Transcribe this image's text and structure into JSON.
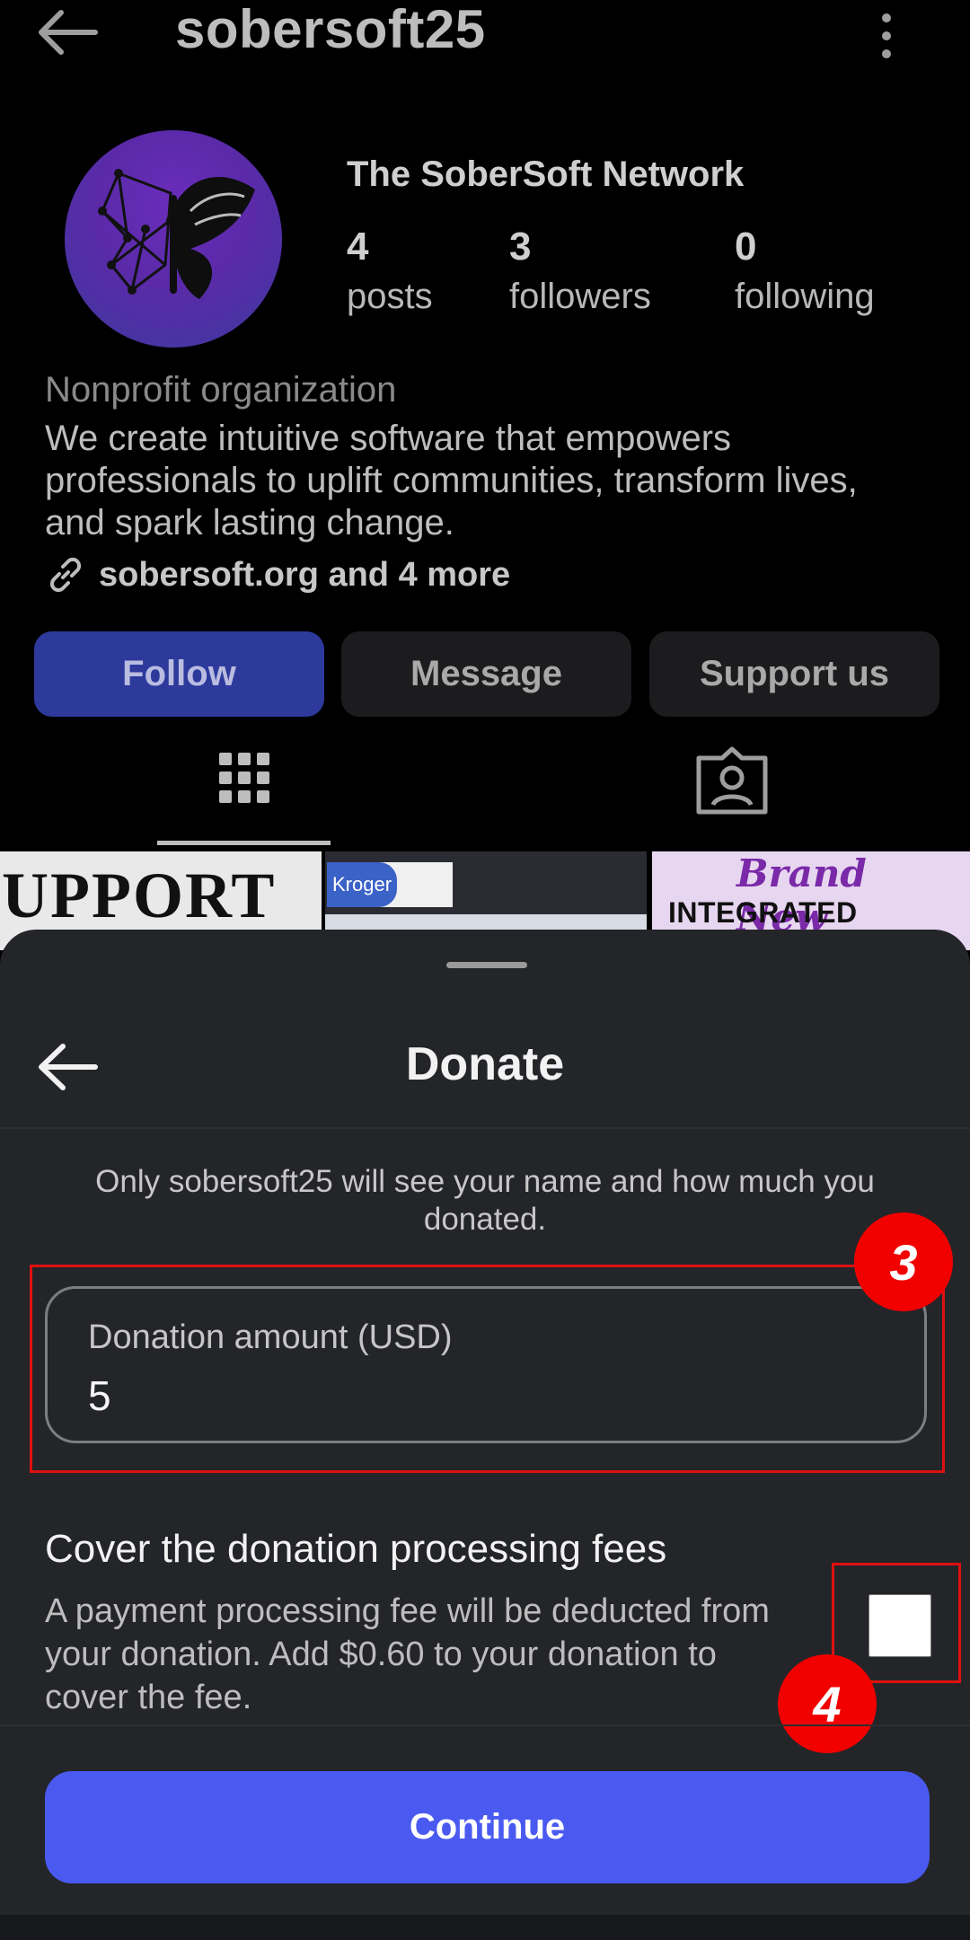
{
  "header": {
    "username": "sobersoft25",
    "back_icon": "arrow-left-icon",
    "menu_icon": "more-vertical-icon"
  },
  "profile": {
    "display_name": "The SoberSoft Network",
    "stats": [
      {
        "value": "4",
        "label": "posts"
      },
      {
        "value": "3",
        "label": "followers"
      },
      {
        "value": "0",
        "label": "following"
      }
    ],
    "category": "Nonprofit organization",
    "bio": "We create intuitive software that empowers professionals to uplift communities, transform lives, and spark lasting change.",
    "link": "sobersoft.org and 4 more",
    "avatar_colors": [
      "#6a2dbb",
      "#3c3a9e"
    ]
  },
  "actions": {
    "follow": "Follow",
    "message": "Message",
    "support": "Support us"
  },
  "tabs": {
    "grid_icon": "grid-icon",
    "tagged_icon": "tagged-person-icon"
  },
  "thumbnails": [
    {
      "text": "UPPORT U"
    },
    {
      "text": "Kroger"
    },
    {
      "script_text": "Brand New",
      "text": "INTEGRATED RECOVERY"
    }
  ],
  "sheet": {
    "title": "Donate",
    "privacy_note": "Only sobersoft25 will see your name and how much you donated.",
    "amount_label": "Donation amount (USD)",
    "amount_value": "5",
    "fee_title": "Cover the donation processing fees",
    "fee_description": "A payment processing fee will be deducted from your donation. Add $0.60 to your donation to cover the fee.",
    "fee_checked": false,
    "continue_label": "Continue"
  },
  "annotations": [
    {
      "number": "3"
    },
    {
      "number": "4"
    }
  ],
  "colors": {
    "follow_bg": "#2d3a9c",
    "continue_bg": "#4a5af0",
    "sheet_bg": "#242529",
    "annotation_red": "#f20000"
  }
}
